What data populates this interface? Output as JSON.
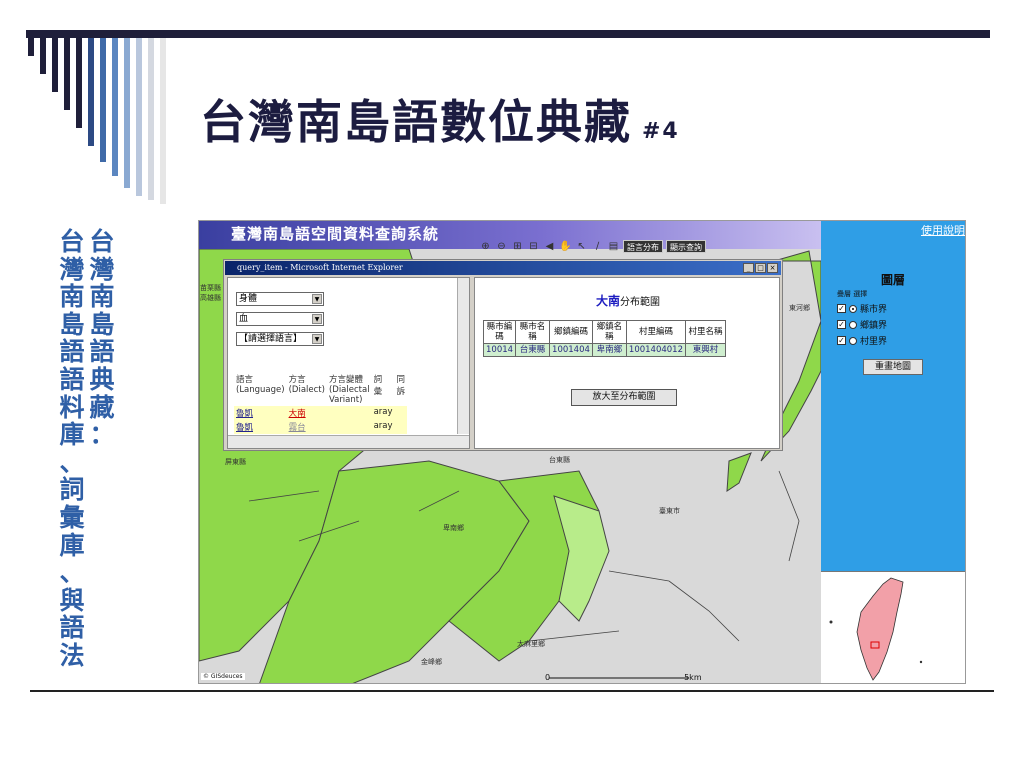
{
  "slide": {
    "title": "台灣南島語數位典藏",
    "title_number": "#4",
    "side_col_1": [
      "台",
      "灣",
      "南",
      "島",
      "語",
      "語",
      "料",
      "庫",
      "、",
      "詞",
      "彙",
      "庫",
      "、",
      "與",
      "語",
      "法"
    ],
    "side_col_2": [
      "台",
      "灣",
      "南",
      "島",
      "語",
      "典",
      "藏",
      "："
    ]
  },
  "app": {
    "title": "臺灣南島語空間資料查詢系統",
    "help_link": "使用說明",
    "tool_icons": [
      "zoom-in-icon",
      "zoom-out-icon",
      "pan-icon",
      "full-extent-icon",
      "back-icon",
      "hand-icon",
      "select-icon",
      "measure-icon",
      "print-icon"
    ],
    "tool_button_1": "語言分布",
    "tool_button_2": "顯示查詢",
    "map_labels": {
      "l1": "苗栗縣",
      "l2": "高雄縣",
      "l3": "屏東縣",
      "l4": "台東縣",
      "l5": "卑南鄉",
      "l6": "臺東市",
      "l7": "太麻里鄉",
      "l8": "金峰鄉",
      "l9": "東河鄉"
    },
    "scale_label": "0",
    "scale_unit": "5km",
    "gis_logo": "© GISdeuces",
    "layers": {
      "title": "圖層",
      "subtitle": "疊層 選擇",
      "items": [
        "縣市界",
        "鄉鎮界",
        "村里界"
      ],
      "redraw": "重畫地圖"
    }
  },
  "popup": {
    "window_title": "query_item - Microsoft Internet Explorer",
    "select_1": "身體",
    "select_2": "血",
    "select_3": "【請選擇語言】",
    "left_headers": [
      "語言",
      "(Language)",
      "方言",
      "(Dialect)",
      "方言變體",
      "(Dialectal",
      "Variant)",
      "詞",
      "彙",
      "同",
      "訴"
    ],
    "rows": [
      {
        "language": "魯凱",
        "dialect": "大南",
        "word": "aray"
      },
      {
        "language": "魯凱",
        "dialect": "霧台",
        "word": "aray"
      }
    ],
    "dist_name": "大南",
    "dist_suffix": "分布範圍",
    "dist_headers": [
      "縣市編碼",
      "縣市名稱",
      "鄉鎮編碼",
      "鄉鎮名稱",
      "村里編碼",
      "村里名稱"
    ],
    "dist_row": [
      "10014",
      "台東縣",
      "1001404",
      "卑南鄉",
      "1001404012",
      "東興村"
    ],
    "zoom_button": "放大至分布範圍",
    "window_buttons": [
      "_",
      "□",
      "×"
    ]
  },
  "colors": {
    "map_green": "#8fd84a",
    "map_gray": "#d9d9d9",
    "panel_blue": "#2f9ee6",
    "title_navy": "#1c1c40",
    "side_blue": "#2f5fa6"
  }
}
